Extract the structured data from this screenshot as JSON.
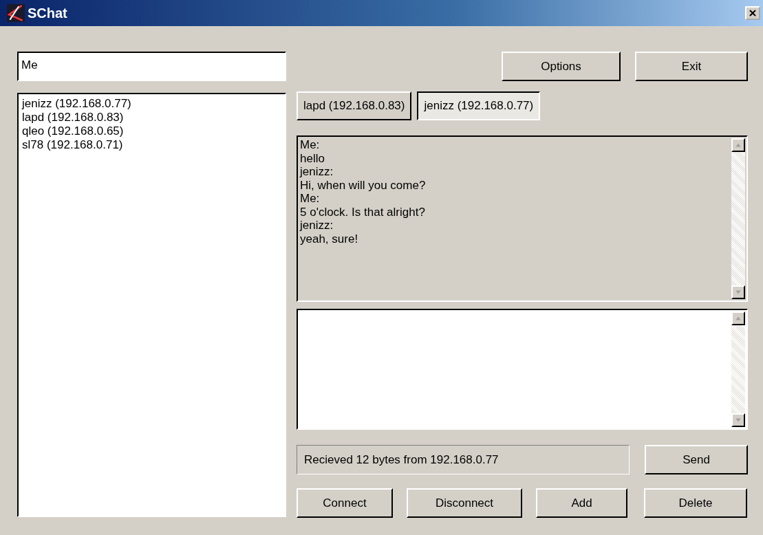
{
  "window": {
    "title": "SChat"
  },
  "name_field": {
    "value": "Me"
  },
  "contacts": [
    "jenizz (192.168.0.77)",
    "lapd (192.168.0.83)",
    "qleo (192.168.0.65)",
    "sl78 (192.168.0.71)"
  ],
  "top_buttons": [
    "Options",
    "Exit"
  ],
  "tabs": [
    {
      "label": "lapd (192.168.0.83)",
      "selected": false
    },
    {
      "label": "jenizz (192.168.0.77)",
      "selected": true
    }
  ],
  "chat_log": [
    "Me:",
    "hello",
    "jenizz:",
    "Hi, when will you come?",
    "Me:",
    "5 o'clock. Is that alright?",
    "jenizz:",
    "yeah, sure!"
  ],
  "status": "Recieved 12 bytes from 192.168.0.77",
  "send_button": "Send",
  "bottom_buttons": [
    "Connect",
    "Disconnect",
    "Add",
    "Delete"
  ]
}
